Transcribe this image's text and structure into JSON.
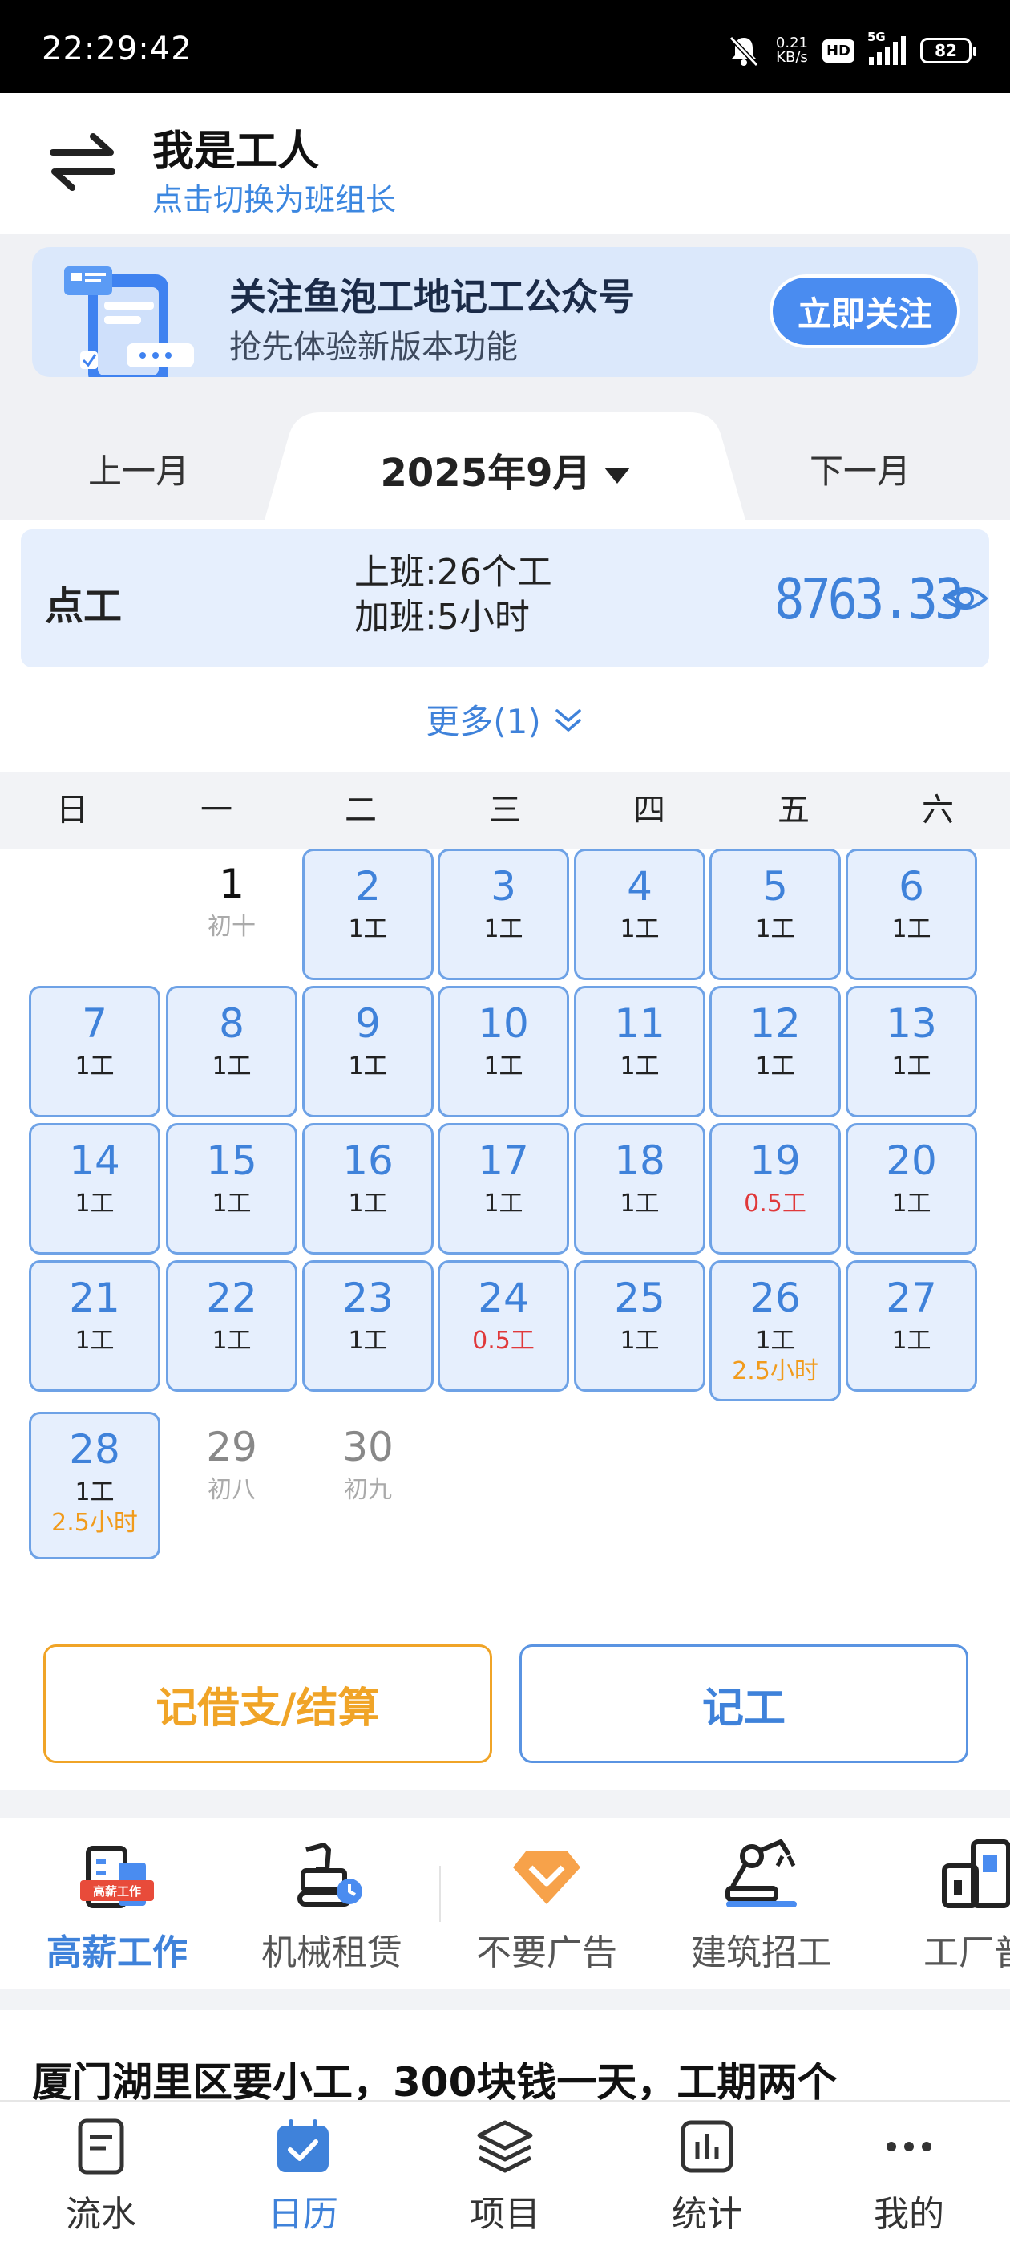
{
  "status_bar": {
    "time": "22:29:42",
    "net_speed_value": "0.21",
    "net_speed_unit": "KB/s",
    "hd": "HD",
    "network": "5G",
    "battery": "82"
  },
  "header": {
    "title": "我是工人",
    "subtitle": "点击切换为班组长"
  },
  "banner": {
    "title": "关注鱼泡工地记工公众号",
    "subtitle": "抢先体验新版本功能",
    "button": "立即关注"
  },
  "month_nav": {
    "prev": "上一月",
    "current": "2025年9月",
    "next": "下一月"
  },
  "summary": {
    "type": "点工",
    "work_line": "上班:26个工",
    "overtime_line": "加班:5小时",
    "amount": "8763.33"
  },
  "more": "更多(1)",
  "weekdays": [
    "日",
    "一",
    "二",
    "三",
    "四",
    "五",
    "六"
  ],
  "calendar": {
    "cells": [
      {
        "day": "1",
        "sub": "初十",
        "marked": false
      },
      {
        "day": "2",
        "sub": "1工",
        "marked": true
      },
      {
        "day": "3",
        "sub": "1工",
        "marked": true
      },
      {
        "day": "4",
        "sub": "1工",
        "marked": true
      },
      {
        "day": "5",
        "sub": "1工",
        "marked": true
      },
      {
        "day": "6",
        "sub": "1工",
        "marked": true
      },
      {
        "day": "7",
        "sub": "1工",
        "marked": true
      },
      {
        "day": "8",
        "sub": "1工",
        "marked": true
      },
      {
        "day": "9",
        "sub": "1工",
        "marked": true
      },
      {
        "day": "10",
        "sub": "1工",
        "marked": true
      },
      {
        "day": "11",
        "sub": "1工",
        "marked": true
      },
      {
        "day": "12",
        "sub": "1工",
        "marked": true
      },
      {
        "day": "13",
        "sub": "1工",
        "marked": true
      },
      {
        "day": "14",
        "sub": "1工",
        "marked": true
      },
      {
        "day": "15",
        "sub": "1工",
        "marked": true
      },
      {
        "day": "16",
        "sub": "1工",
        "marked": true
      },
      {
        "day": "17",
        "sub": "1工",
        "marked": true
      },
      {
        "day": "18",
        "sub": "1工",
        "marked": true
      },
      {
        "day": "19",
        "sub": "0.5工",
        "marked": true,
        "half": true
      },
      {
        "day": "20",
        "sub": "1工",
        "marked": true
      },
      {
        "day": "21",
        "sub": "1工",
        "marked": true
      },
      {
        "day": "22",
        "sub": "1工",
        "marked": true
      },
      {
        "day": "23",
        "sub": "1工",
        "marked": true
      },
      {
        "day": "24",
        "sub": "0.5工",
        "marked": true,
        "half": true
      },
      {
        "day": "25",
        "sub": "1工",
        "marked": true
      },
      {
        "day": "26",
        "sub": "1工",
        "overtime": "2.5小时",
        "marked": true
      },
      {
        "day": "27",
        "sub": "1工",
        "marked": true
      },
      {
        "day": "28",
        "sub": "1工",
        "overtime": "2.5小时",
        "marked": true
      },
      {
        "day": "29",
        "sub": "初八",
        "marked": false
      },
      {
        "day": "30",
        "sub": "初九",
        "marked": false
      }
    ]
  },
  "actions": {
    "settle": "记借支/结算",
    "record": "记工"
  },
  "services": [
    {
      "label": "高薪工作",
      "badge": "高薪工作",
      "icon": "building-job-icon"
    },
    {
      "label": "机械租赁",
      "icon": "excavator-icon"
    },
    {
      "label": "不要广告",
      "icon": "no-ads-diamond-icon"
    },
    {
      "label": "建筑招工",
      "icon": "robot-arm-icon"
    },
    {
      "label": "工厂普",
      "icon": "factory-icon"
    }
  ],
  "news": {
    "headline": "厦门湖里区要小工，300块钱一天，工期两个"
  },
  "bottom_nav": [
    {
      "label": "流水",
      "icon": "document-icon"
    },
    {
      "label": "日历",
      "icon": "calendar-check-icon"
    },
    {
      "label": "项目",
      "icon": "layers-icon"
    },
    {
      "label": "统计",
      "icon": "bar-chart-icon"
    },
    {
      "label": "我的",
      "icon": "more-dots-icon"
    }
  ],
  "colors": {
    "accent_blue": "#3f82da",
    "orange": "#f0a427",
    "red": "#e0393b",
    "cell_bg": "#e6effd"
  }
}
